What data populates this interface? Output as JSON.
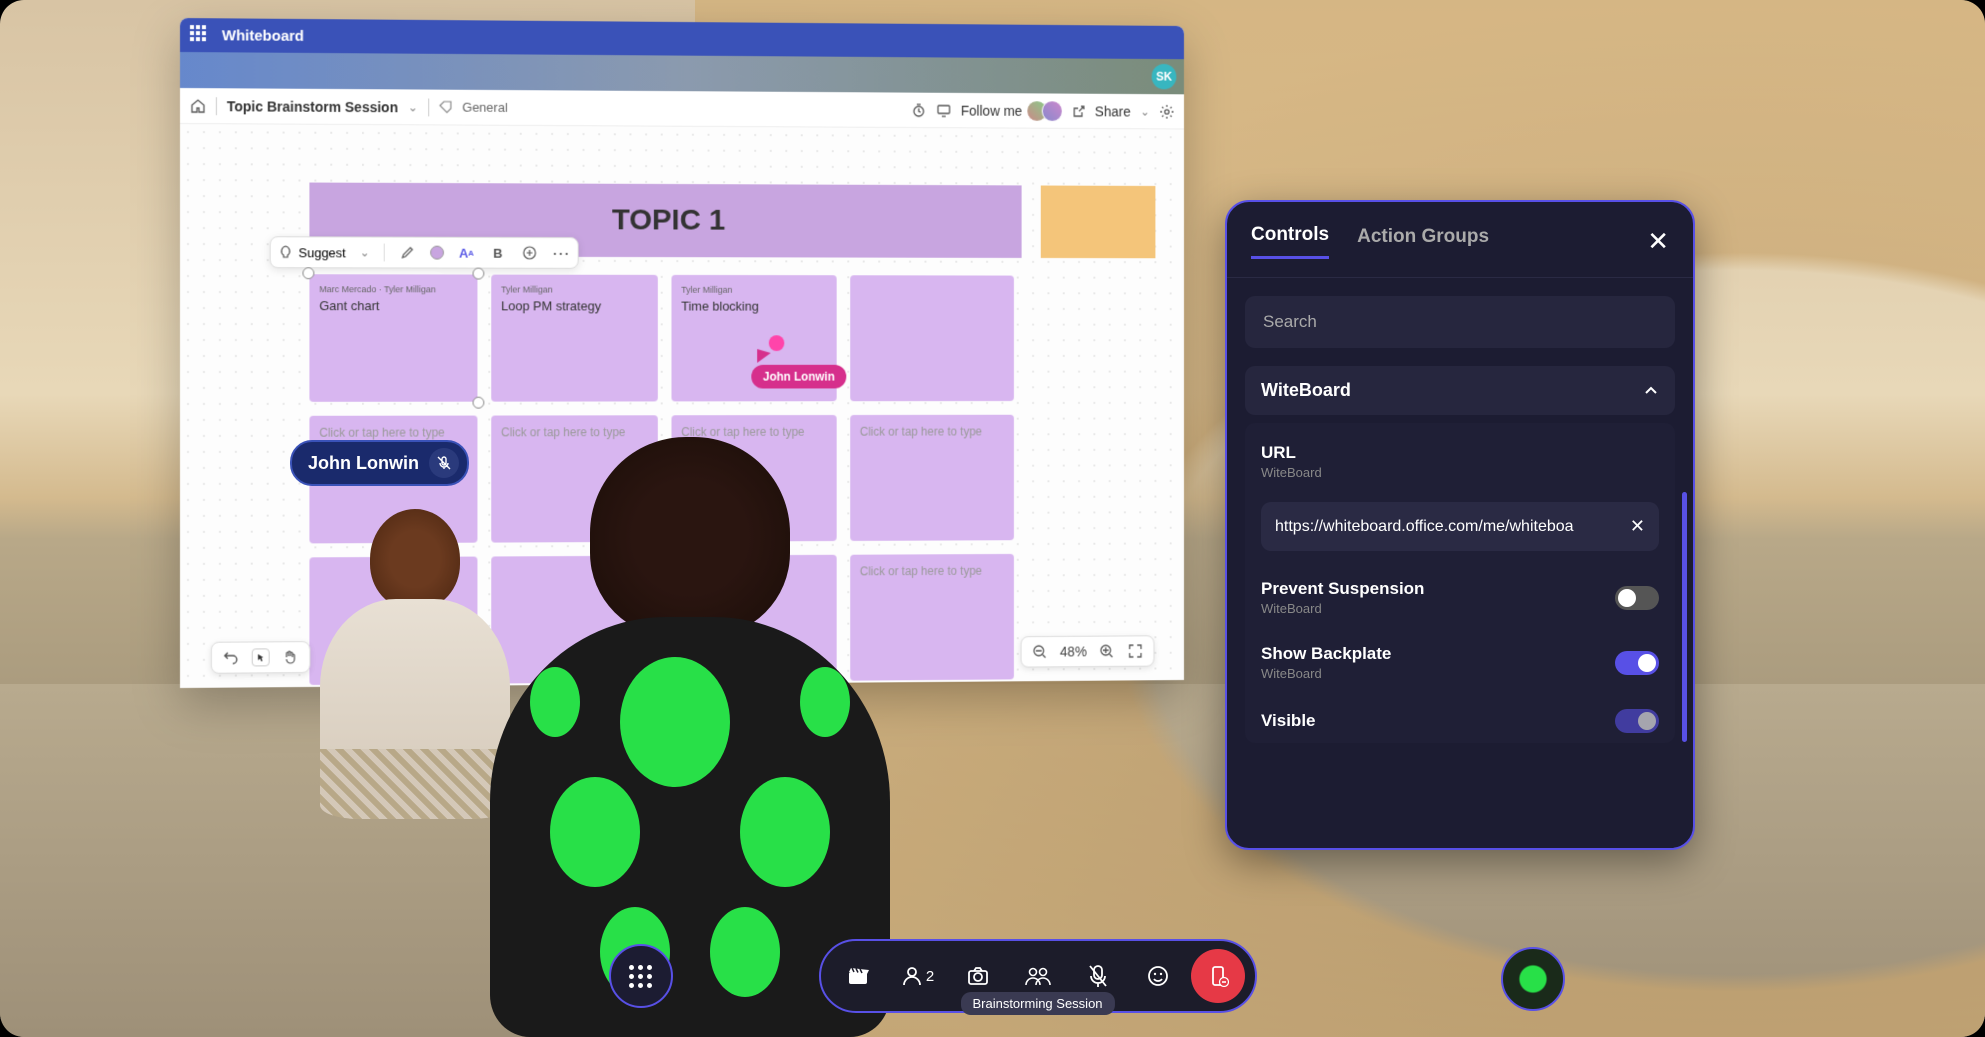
{
  "whiteboard": {
    "app_title": "Whiteboard",
    "doc_title": "Topic Brainstorm Session",
    "tag": "General",
    "follow_label": "Follow me",
    "share_label": "Share",
    "sk_badge": "SK",
    "topic_header": "TOPIC 1",
    "suggest_label": "Suggest",
    "bold_symbol": "B",
    "notes": [
      {
        "author": "Marc Mercado · Tyler Milligan",
        "text": "Gant chart"
      },
      {
        "author": "Tyler Milligan",
        "text": "Loop PM strategy"
      },
      {
        "author": "Tyler Milligan",
        "text": "Time blocking"
      }
    ],
    "placeholder_text": "Click or tap here to type",
    "cursor_user": "John Lonwin",
    "zoom": "48%"
  },
  "participant_pill": {
    "name": "John Lonwin"
  },
  "controls": {
    "tab_controls": "Controls",
    "tab_actiongroups": "Action Groups",
    "search_placeholder": "Search",
    "section_title": "WiteBoard",
    "url_label": "URL",
    "url_sub": "WiteBoard",
    "url_value": "https://whiteboard.office.com/me/whiteboa",
    "prevent_label": "Prevent Suspension",
    "prevent_sub": "WiteBoard",
    "backplate_label": "Show Backplate",
    "backplate_sub": "WiteBoard",
    "visible_label": "Visible"
  },
  "dock": {
    "participant_count": "2",
    "session_label": "Brainstorming Session"
  },
  "icons": {
    "chevron_down": "⌄",
    "chevron_up": "⌃",
    "close": "✕",
    "more": "⋯",
    "home": "⌂",
    "tag": "⬦",
    "timer": "⏱",
    "follow": "▭",
    "share": "↗",
    "gear": "⚙",
    "undo": "↶",
    "pointer": "▶",
    "hand": "✋",
    "zoom_out": "−",
    "zoom_in": "+",
    "fit": "⛶",
    "edit": "✎",
    "text_style": "A",
    "add": "⊕",
    "mic_muted": "🎤",
    "clapper": "🎬",
    "people": "👥",
    "camera": "📷",
    "group": "👨‍👩",
    "react": "☺",
    "leave": "⍈"
  }
}
